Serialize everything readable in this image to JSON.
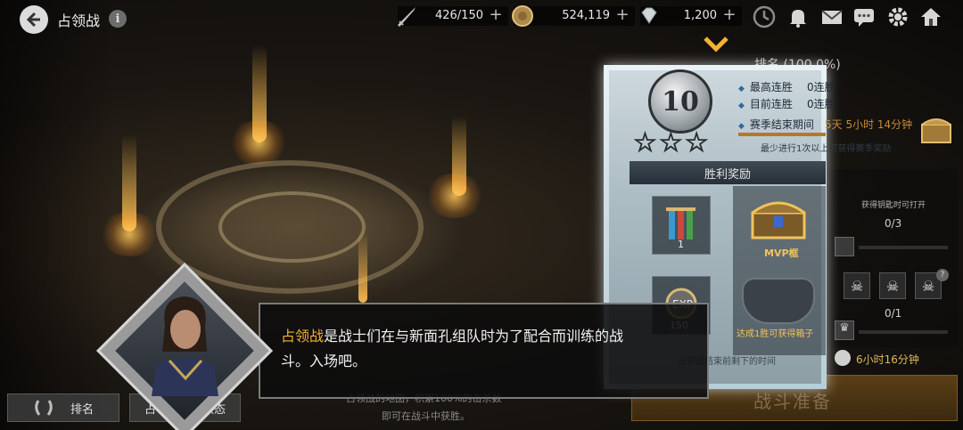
{
  "header": {
    "title": "占领战",
    "info_icon": "i",
    "resources": [
      {
        "icon": "sword-icon",
        "value": "426/150"
      },
      {
        "icon": "coin-icon",
        "value": "524,119"
      },
      {
        "icon": "diamond-icon",
        "value": "1,200"
      }
    ],
    "plus": "+",
    "top_icons": [
      "clock-icon",
      "bell-icon",
      "mail-icon",
      "chat-icon",
      "gear-icon",
      "home-icon"
    ]
  },
  "rank_panel": {
    "rank_label": "排名 (100.0%)",
    "rank_number": "10",
    "stars": "☆☆☆",
    "stats": [
      {
        "label": "最高连胜",
        "value": "0连胜"
      },
      {
        "label": "目前连胜",
        "value": "0连胜"
      },
      {
        "label": "赛季结束期间",
        "value": "5天 5小时 14分钟"
      }
    ],
    "min_requirement": "最少进行1次以上可获得赛季奖励"
  },
  "rewards": {
    "title": "胜利奖励",
    "item_count": "1",
    "item2_count": "150",
    "mvp_label": "MVP框",
    "win_text": "达成1胜可获得箱子",
    "bottom_text": "占领战结束前剩下的时间",
    "open_hint": "获得钥匙时可打开",
    "count_a": "0/3",
    "count_b": "0/1",
    "timer": "6小时16分钟"
  },
  "battle_button": "战斗准备",
  "bottom": {
    "rank_button": "排名",
    "status_button": "占领战适用状态",
    "hint_line1": "占领战的地图，积累100%的击杀数",
    "hint_line2": "即可在战斗中获胜。"
  },
  "dialog": {
    "highlight": "占领战",
    "line1_rest": "是战士们在与新面孔组队时为了配合而训练的战",
    "line2": "斗。入场吧。"
  },
  "colors": {
    "accent_gold": "#f2b233",
    "mvp_gold": "#f0c35a"
  }
}
